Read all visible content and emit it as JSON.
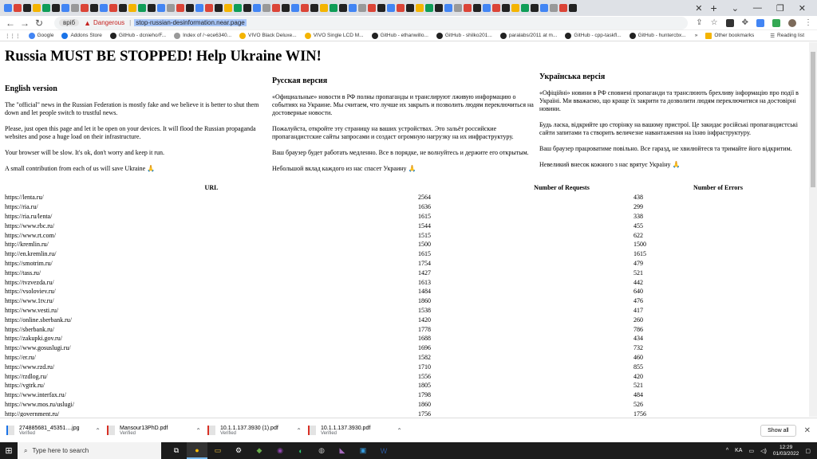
{
  "browser": {
    "url_chip": "вріб",
    "security_label": "Dangerous",
    "url": "stop-russian-desinformation.near.page",
    "bookmarks": [
      "Google",
      "Addons Store",
      "GitHub - dcnieho/F...",
      "Index of /~ece6340...",
      "VIVO Black Deluxe...",
      "VIVO Single LCD M...",
      "GitHub - ethanwillo...",
      "GitHub - shilko201...",
      "paralabs/2011 at m...",
      "GitHub - cpp-taskfl...",
      "GitHub - huntercbx..."
    ],
    "other_bookmarks": "Other bookmarks",
    "reading_list": "Reading list"
  },
  "page": {
    "title": "Russia MUST BE STOPPED! Help Ukraine WIN!",
    "en": {
      "heading": "English version",
      "p1": "The \"official\" news in the Russian Federation is mostly fake and we believe it is better to shut them down and let people switch to trustful news.",
      "p2": "Please, just open this page and let it be open on your devices. It will flood the Russian propaganda websites and pose a huge load on their infrastructure.",
      "p3": "Your browser will be slow. It's ok, don't worry and keep it run.",
      "p4": "A small contribution from each of us will save Ukraine 🙏"
    },
    "ru": {
      "heading": "Русская версия",
      "p1": "«Официальные» новости в РФ полны пропаганды и транслируют лживую информацию о событиях на Украине. Мы считаем, что лучше их закрыть и позволить людям переключиться на достоверные новости.",
      "p2": "Пожалуйста, откройте эту страницу на ваших устройствах. Это зальёт российские пропагандистские сайты запросами и создаст огромную нагрузку на их инфраструктуру.",
      "p3": "Ваш браузер будет работать медленно. Все в порядке, не волнуйтесь и держите его открытым.",
      "p4": "Небольшой вклад каждого из нас спасет Украину 🙏"
    },
    "ua": {
      "heading": "Українська версія",
      "p1": "«Офіційні» новини в РФ сповнені пропаганди та транслюють брехливу інформацію про події в Україні. Ми вважаємо, що краще їх закрити та дозволити людям переключитися на достовірні новини.",
      "p2": "Будь ласка, відкрийте цю сторінку на вашому пристрої. Це закидає російські пропагандистські сайти запитами та створить величезне навантаження на їхню інфраструктуру.",
      "p3": "Ваш браузер працюватиме повільно. Все гаразд, не хвилюйтеся та тримайте його відкритим.",
      "p4": "Невеликий внесок кожного з нас врятує Україну 🙏"
    },
    "table": {
      "headers": [
        "URL",
        "Number of Requests",
        "Number of Errors"
      ],
      "rows": [
        [
          "https://lenta.ru/",
          "2564",
          "438"
        ],
        [
          "https://ria.ru/",
          "1636",
          "299"
        ],
        [
          "https://ria.ru/lenta/",
          "1615",
          "338"
        ],
        [
          "https://www.rbc.ru/",
          "1544",
          "455"
        ],
        [
          "https://www.rt.com/",
          "1515",
          "622"
        ],
        [
          "http://kremlin.ru/",
          "1500",
          "1500"
        ],
        [
          "http://en.kremlin.ru/",
          "1615",
          "1615"
        ],
        [
          "https://smotrim.ru/",
          "1754",
          "479"
        ],
        [
          "https://tass.ru/",
          "1427",
          "521"
        ],
        [
          "https://tvzvezda.ru/",
          "1613",
          "442"
        ],
        [
          "https://vsoloviev.ru/",
          "1484",
          "640"
        ],
        [
          "https://www.1tv.ru/",
          "1860",
          "476"
        ],
        [
          "https://www.vesti.ru/",
          "1538",
          "417"
        ],
        [
          "https://online.sberbank.ru/",
          "1420",
          "260"
        ],
        [
          "https://sberbank.ru/",
          "1778",
          "786"
        ],
        [
          "https://zakupki.gov.ru/",
          "1688",
          "434"
        ],
        [
          "https://www.gosuslugi.ru/",
          "1696",
          "732"
        ],
        [
          "https://er.ru/",
          "1582",
          "460"
        ],
        [
          "https://www.rzd.ru/",
          "1710",
          "855"
        ],
        [
          "https://rzdlog.ru/",
          "1556",
          "420"
        ],
        [
          "https://vgtrk.ru/",
          "1805",
          "521"
        ],
        [
          "https://www.interfax.ru/",
          "1798",
          "484"
        ],
        [
          "https://www.mos.ru/uslugi/",
          "1860",
          "526"
        ],
        [
          "http://government.ru/",
          "1756",
          "1756"
        ]
      ]
    }
  },
  "downloads": {
    "items": [
      {
        "name": "274885681_45351....jpg",
        "status": "Verified"
      },
      {
        "name": "Mansour13PhD.pdf",
        "status": "Verified"
      },
      {
        "name": "10.1.1.137.3930 (1).pdf",
        "status": "Verified"
      },
      {
        "name": "10.1.1.137.3930.pdf",
        "status": "Verified"
      }
    ],
    "show_all": "Show all"
  },
  "taskbar": {
    "search_placeholder": "Type here to search",
    "lang": "KA",
    "time": "12:29",
    "date": "01/03/2022"
  }
}
